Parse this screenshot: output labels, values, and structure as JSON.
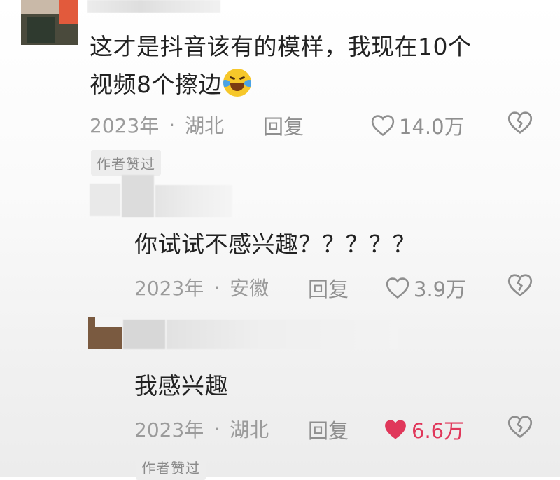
{
  "comments": [
    {
      "text_line1": "这才是抖音该有的模样，我现在10个",
      "text_line2": "视频8个擦边",
      "emoji": "laughing-crying-emoji",
      "year": "2023年",
      "sep": "·",
      "location": "湖北",
      "reply_label": "回复",
      "likes": "14.0万",
      "liked": false,
      "author_liked_badge": "作者赞过"
    },
    {
      "text_line1": "你试试不感兴趣？？？？？",
      "year": "2023年",
      "sep": "·",
      "location": "安徽",
      "reply_label": "回复",
      "likes": "3.9万",
      "liked": false
    },
    {
      "text_line1": "我感兴趣",
      "year": "2023年",
      "sep": "·",
      "location": "湖北",
      "reply_label": "回复",
      "likes": "6.6万",
      "liked": true,
      "author_liked_badge": "作者赞过"
    }
  ],
  "colors": {
    "liked_heart": "#e0375a",
    "meta_gray": "#9b9b9b",
    "badge_bg": "#ededed"
  },
  "icons": {
    "like": "heart-outline-icon",
    "liked": "heart-filled-icon",
    "dislike": "broken-heart-icon"
  }
}
